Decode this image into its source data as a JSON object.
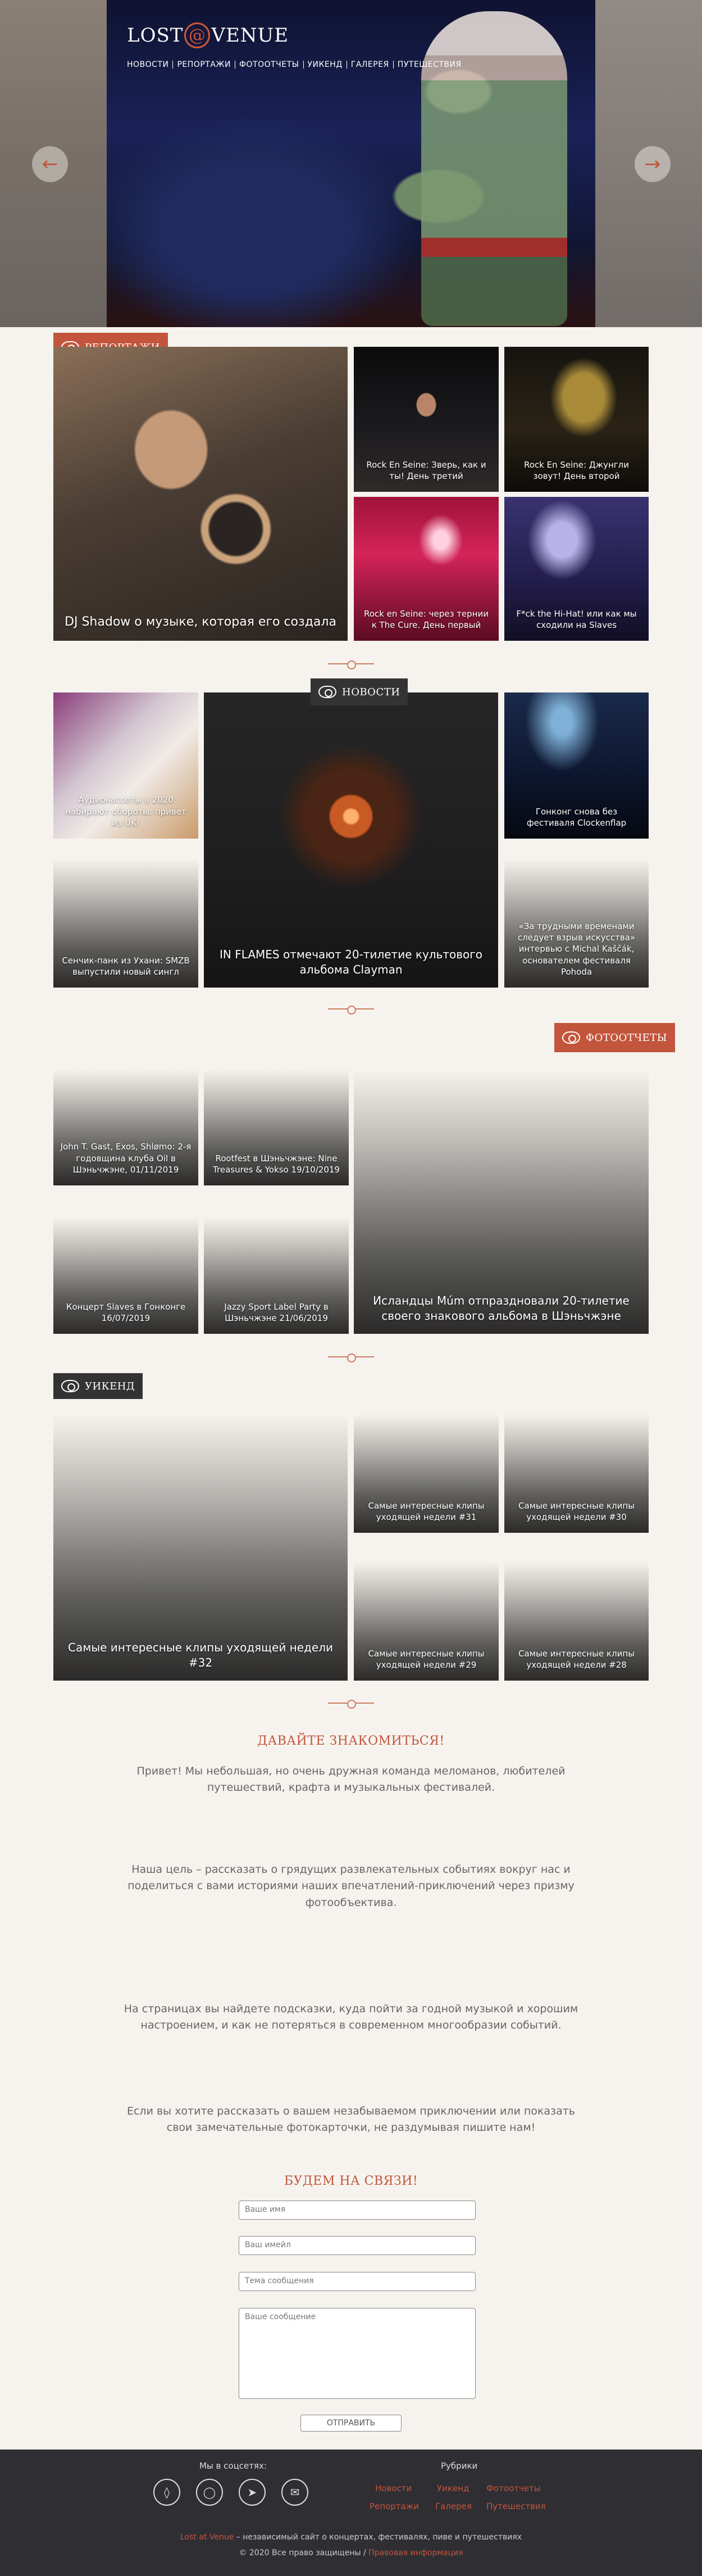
{
  "site": {
    "logo_left": "LOST",
    "logo_at": "@",
    "logo_right": "VENUE"
  },
  "nav": [
    "НОВОСТИ",
    "РЕПОРТАЖИ",
    "ФОТООТЧЕТЫ",
    "УИКЕНД",
    "ГАЛЕРЕЯ",
    "ПУТЕШЕСТВИЯ"
  ],
  "hero": {
    "prev_icon": "arrow-left-icon",
    "next_icon": "arrow-right-icon"
  },
  "reports": {
    "tag": "РЕПОРТАЖИ",
    "items": [
      "DJ Shadow о музыке, которая его создала",
      "Rock En Seine: Зверь, как и ты! День третий",
      "Rock En Seine: Джунгли зовут! День второй",
      "Rock en Seine: через тернии к The Cure. День первый",
      "F*ck the Hi-Hat! или как мы сходили на Slaves"
    ]
  },
  "news": {
    "tag": "НОВОСТИ",
    "items": [
      "Аудиокассеты в 2020 набирают обороты: привет из UK!",
      "IN FLAMES отмечают 20-тилетие культового альбома Clayman",
      "Гонконг снова без фестиваля Clockenflap",
      "Сенчик-панк из Ухани: SMZB выпустили новый сингл",
      "«За трудными временами следует взрыв искусства» интервью с Michal Kaščák, основателем фестиваля Pohoda"
    ]
  },
  "photo": {
    "tag": "ФОТООТЧЕТЫ",
    "items": [
      "John T. Gast, Exos, Shlømo: 2-я годовщина клуба Oil в Шэньчжэне, 01/11/2019",
      "Rootfest в Шэньчжэне: Nine Treasures & Yokso 19/10/2019",
      "Исландцы Múm отпраздновали 20-тилетие своего знакового альбома в Шэньчжэне",
      "Концерт Slaves в Гонконге 16/07/2019",
      "Jazzy Sport Label Party в Шэньчжэне 21/06/2019"
    ]
  },
  "weekend": {
    "tag": "УИКЕНД",
    "items": [
      "Самые интересные клипы уходящей недели #32",
      "Самые интересные клипы уходящей недели #31",
      "Самые интересные клипы уходящей недели #30",
      "Самые интересные клипы уходящей недели #29",
      "Самые интересные клипы уходящей недели #28"
    ]
  },
  "about": {
    "title": "ДАВАЙТЕ ЗНАКОМИТЬСЯ!",
    "paragraphs": [
      "Привет! Мы небольшая, но очень дружная команда меломанов, любителей путешествий, крафта и музыкальных фестивалей.",
      "Наша цель – рассказать о грядущих развлекательных событиях вокруг нас и поделиться с вами историями наших впечатлений-приключений через призму фотообъектива.",
      "На страницах вы найдете подсказки, куда пойти за годной музыкой и хорошим настроением, и как не потеряться в современном многообразии событий.",
      "Если вы хотите рассказать о вашем незабываемом приключении или показать свои замечательные фотокарточки, не раздумывая пишите нам!"
    ]
  },
  "contact": {
    "title": "БУДЕМ НА СВЯЗИ!",
    "name": "Ваше имя",
    "email": "Ваш имейл",
    "subject": "Тема сообщения",
    "message": "Ваше сообщение",
    "submit": "ОТПРАВИТЬ"
  },
  "footer": {
    "social_title": "Мы в соцсетях:",
    "social_icons": [
      "vk-icon",
      "instagram-icon",
      "telegram-icon",
      "messenger-icon"
    ],
    "rubrics_title": "Рубрики",
    "rubrics": [
      "Новости",
      "Уикенд",
      "Фотоотчеты",
      "Репортажи",
      "Галерея",
      "Путешествия"
    ],
    "tagline_brand": "Lost at Venue",
    "tagline_text": " – независимый сайт о концертах, фестивалях, пиве и путешествиях",
    "copyright": "© 2020 Все право защищены /",
    "legal": " Правовая информация"
  }
}
